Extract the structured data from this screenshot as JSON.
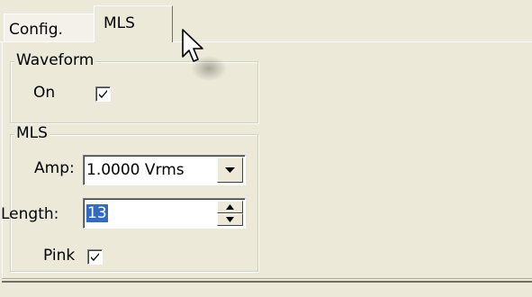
{
  "tabs": [
    {
      "label": "Config."
    },
    {
      "label": "MLS",
      "active": true
    }
  ],
  "waveform": {
    "title": "Waveform",
    "on_label": "On",
    "on_checked": true
  },
  "mls": {
    "title": "MLS",
    "amp_label": "Amp:",
    "amp_value": "1.0000 Vrms",
    "length_label": "Length:",
    "length_value": "13",
    "pink_label": "Pink",
    "pink_checked": true
  },
  "icons": {
    "dropdown": "chevron-down-icon",
    "spin_up": "spin-up-icon",
    "spin_down": "spin-down-icon",
    "check": "check-icon",
    "cursor": "mouse-pointer-icon"
  },
  "colors": {
    "background": "#ece9d8",
    "selection": "#316ac5"
  }
}
